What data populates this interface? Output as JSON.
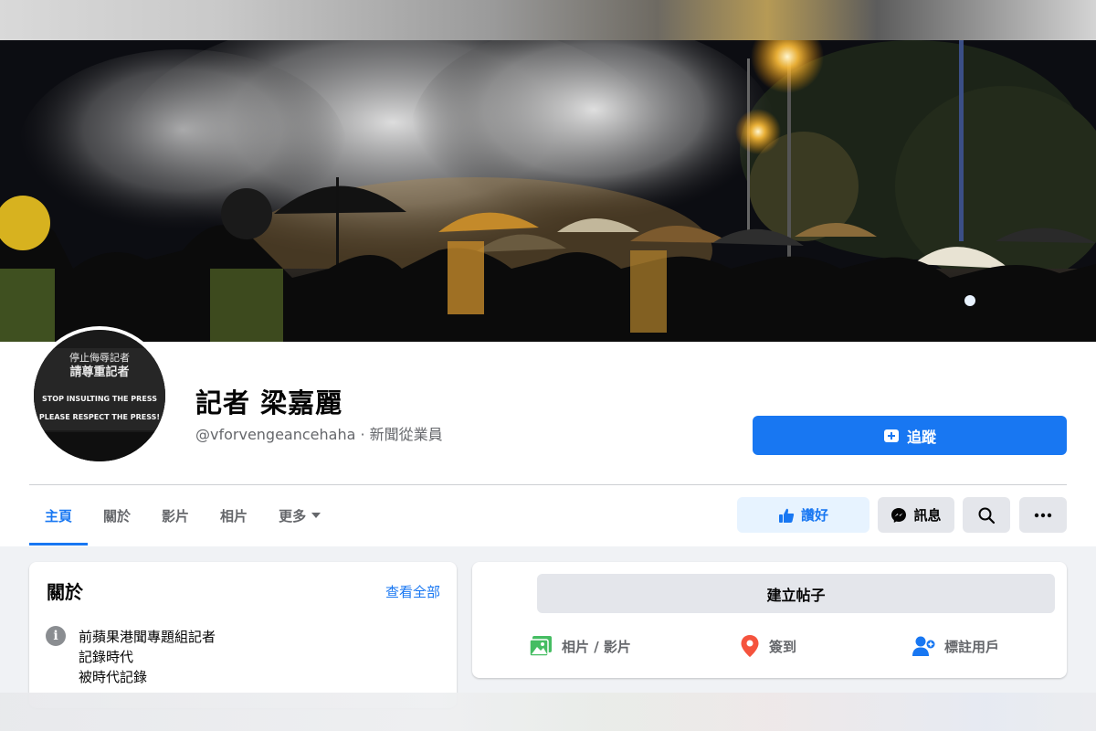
{
  "profile": {
    "name": "記者 梁嘉麗",
    "handle_line": "@vforvengeancehaha · 新聞從業員",
    "follow_label": "追蹤"
  },
  "avatar_banner": {
    "line1": "停止侮辱記者",
    "line2": "請尊重記者",
    "line3": "STOP INSULTING THE PRESS",
    "line4": "PLEASE RESPECT THE PRESS!"
  },
  "tabs": [
    {
      "label": "主頁",
      "active": true
    },
    {
      "label": "關於"
    },
    {
      "label": "影片"
    },
    {
      "label": "相片"
    },
    {
      "label": "更多"
    }
  ],
  "actions": {
    "like_label": "讚好",
    "message_label": "訊息"
  },
  "about": {
    "title": "關於",
    "see_all": "查看全部",
    "bio_lines": [
      "前蘋果港聞專題組記者",
      "記錄時代",
      "被時代記錄"
    ]
  },
  "composer": {
    "create_post": "建立帖子",
    "photo_video": "相片 / 影片",
    "check_in": "簽到",
    "tag_people": "標註用戶"
  },
  "colors": {
    "accent": "#1877f2",
    "like_bg": "#e7f3ff",
    "button_gray": "#e4e6eb",
    "page_bg": "#f0f2f5",
    "secondary_text": "#65676b"
  },
  "icons": [
    "follow-icon",
    "thumbs-up-icon",
    "messenger-icon",
    "search-icon",
    "more-icon",
    "info-icon",
    "photo-icon",
    "location-pin-icon",
    "tag-people-icon",
    "caret-down-icon"
  ]
}
